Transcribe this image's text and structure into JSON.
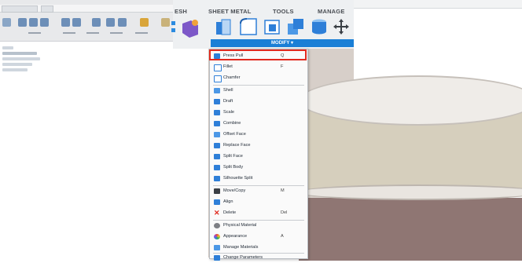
{
  "ribbon": {
    "tabs": [
      "ESH",
      "SHEET METAL",
      "TOOLS",
      "MANAGE"
    ],
    "active_panel": "MODIFY ▾"
  },
  "menu": {
    "items": [
      {
        "label": "Press Pull",
        "shortcut": "Q",
        "icon": "press-pull-icon"
      },
      {
        "label": "Fillet",
        "shortcut": "F",
        "icon": "fillet-icon"
      },
      {
        "label": "Chamfer",
        "shortcut": "",
        "icon": "chamfer-icon"
      },
      {
        "label": "Shell",
        "shortcut": "",
        "icon": "shell-icon"
      },
      {
        "label": "Draft",
        "shortcut": "",
        "icon": "draft-icon"
      },
      {
        "label": "Scale",
        "shortcut": "",
        "icon": "scale-icon"
      },
      {
        "label": "Combine",
        "shortcut": "",
        "icon": "combine-icon"
      },
      {
        "label": "Offset Face",
        "shortcut": "",
        "icon": "offset-face-icon"
      },
      {
        "label": "Replace Face",
        "shortcut": "",
        "icon": "replace-face-icon"
      },
      {
        "label": "Split Face",
        "shortcut": "",
        "icon": "split-face-icon"
      },
      {
        "label": "Split Body",
        "shortcut": "",
        "icon": "split-body-icon"
      },
      {
        "label": "Silhouette Split",
        "shortcut": "",
        "icon": "silhouette-split-icon"
      },
      {
        "label": "Move/Copy",
        "shortcut": "M",
        "icon": "move-icon"
      },
      {
        "label": "Align",
        "shortcut": "",
        "icon": "align-icon"
      },
      {
        "label": "Delete",
        "shortcut": "Del",
        "icon": "delete-icon"
      },
      {
        "label": "Physical Material",
        "shortcut": "",
        "icon": "physical-material-icon"
      },
      {
        "label": "Appearance",
        "shortcut": "A",
        "icon": "appearance-icon"
      },
      {
        "label": "Manage Materials",
        "shortcut": "",
        "icon": "manage-materials-icon"
      },
      {
        "label": "Change Parameters",
        "shortcut": "",
        "icon": "parameters-icon"
      }
    ]
  },
  "colors": {
    "accent": "#1a7fd6",
    "highlight": "#e12a1f"
  }
}
